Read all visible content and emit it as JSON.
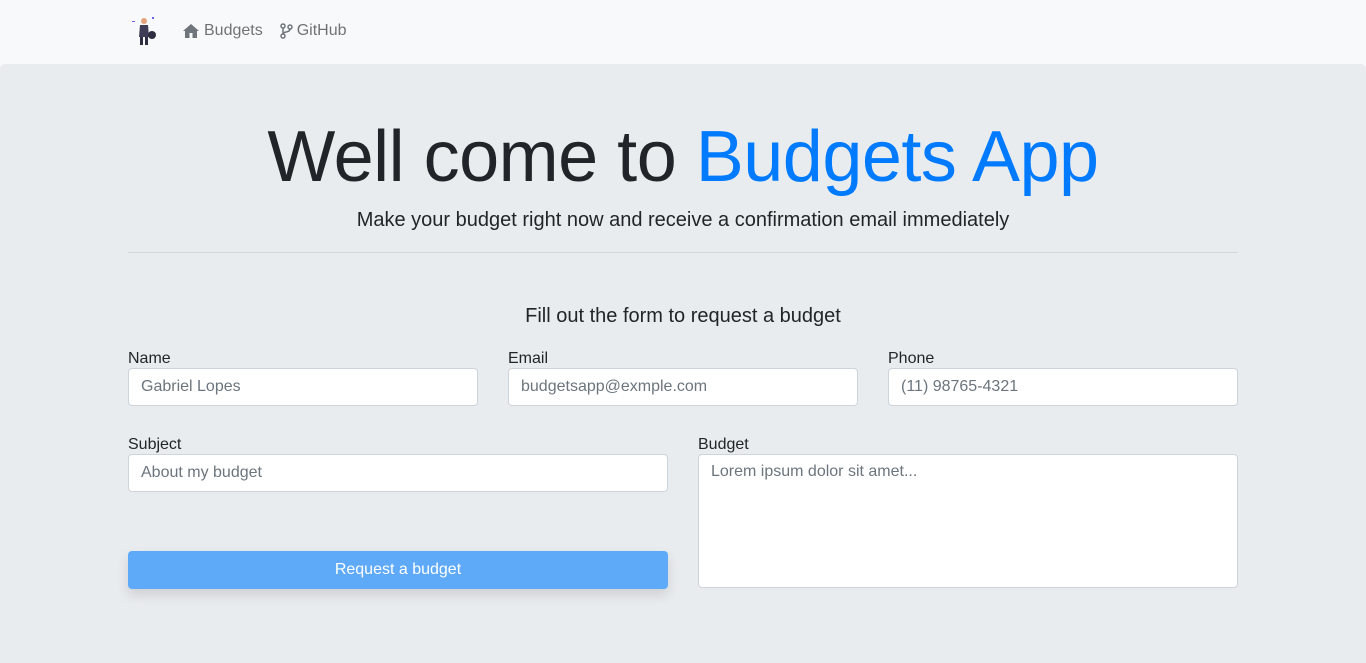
{
  "nav": {
    "links": [
      {
        "label": "Budgets",
        "icon": "home-icon"
      },
      {
        "label": "GitHub",
        "icon": "git-branch-icon"
      }
    ]
  },
  "hero": {
    "title_prefix": "Well come to ",
    "title_accent": "Budgets App",
    "lead": "Make your budget right now and receive a confirmation email immediately"
  },
  "form": {
    "title": "Fill out the form to request a budget",
    "name": {
      "label": "Name",
      "placeholder": "Gabriel Lopes"
    },
    "email": {
      "label": "Email",
      "placeholder": "budgetsapp@exmple.com"
    },
    "phone": {
      "label": "Phone",
      "placeholder": "(11) 98765-4321"
    },
    "subject": {
      "label": "Subject",
      "placeholder": "About my budget"
    },
    "budget": {
      "label": "Budget",
      "placeholder": "Lorem ipsum dolor sit amet..."
    },
    "submit_label": "Request a budget"
  },
  "colors": {
    "accent": "#007bff",
    "button": "#5ea9f8",
    "jumbotron_bg": "#e9ecef",
    "navbar_bg": "#f8f9fa"
  }
}
